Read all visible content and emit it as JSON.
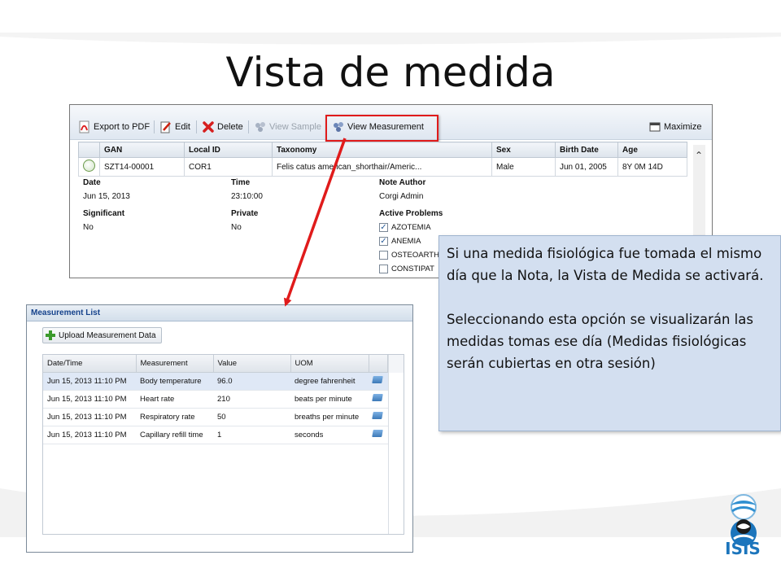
{
  "slide": {
    "title": "Vista de medida"
  },
  "toolbar": {
    "export_pdf": "Export to PDF",
    "edit": "Edit",
    "delete": "Delete",
    "view_sample": "View Sample",
    "view_measurement": "View Measurement",
    "maximize": "Maximize"
  },
  "animal_table": {
    "columns": [
      "GAN",
      "Local ID",
      "Taxonomy",
      "Sex",
      "Birth Date",
      "Age"
    ],
    "row": {
      "gan": "SZT14-00001",
      "local_id": "COR1",
      "taxonomy": "Felis catus american_shorthair/Americ...",
      "sex": "Male",
      "birth_date": "Jun 01, 2005",
      "age": "8Y 0M 14D"
    }
  },
  "note": {
    "date_label": "Date",
    "date_value": "Jun 15, 2013",
    "time_label": "Time",
    "time_value": "23:10:00",
    "author_label": "Note Author",
    "author_value": "Corgi Admin",
    "significant_label": "Significant",
    "significant_value": "No",
    "private_label": "Private",
    "private_value": "No",
    "problems_label": "Active Problems",
    "problems": [
      {
        "label": "AZOTEMIA",
        "checked": true
      },
      {
        "label": "ANEMIA",
        "checked": true
      },
      {
        "label": "OSTEOARTH",
        "checked": false
      },
      {
        "label": "CONSTIPAT",
        "checked": false
      }
    ]
  },
  "measurement_panel": {
    "title": "Measurement List",
    "upload_label": "Upload Measurement Data",
    "columns": [
      "Date/Time",
      "Measurement",
      "Value",
      "UOM"
    ],
    "rows": [
      {
        "datetime": "Jun 15, 2013 11:10 PM",
        "measurement": "Body temperature",
        "value": "96.0",
        "uom": "degree fahrenheit"
      },
      {
        "datetime": "Jun 15, 2013 11:10 PM",
        "measurement": "Heart rate",
        "value": "210",
        "uom": "beats per minute"
      },
      {
        "datetime": "Jun 15, 2013 11:10 PM",
        "measurement": "Respiratory rate",
        "value": "50",
        "uom": "breaths per minute"
      },
      {
        "datetime": "Jun 15, 2013 11:10 PM",
        "measurement": "Capillary refill time",
        "value": "1",
        "uom": "seconds"
      }
    ]
  },
  "callout": {
    "paragraph1": "Si una medida fisiológica fue tomada el mismo día que la Nota, la Vista de Medida se activará.",
    "paragraph2": "Seleccionando esta opción se visualizarán las medidas tomas ese día (Medidas fisiológicas serán cubiertas en otra sesión)"
  },
  "logo": {
    "text": "ISIS"
  },
  "colors": {
    "highlight": "#e01b1b",
    "callout_bg": "#d3dff0",
    "logo_blue": "#1c75bc"
  }
}
